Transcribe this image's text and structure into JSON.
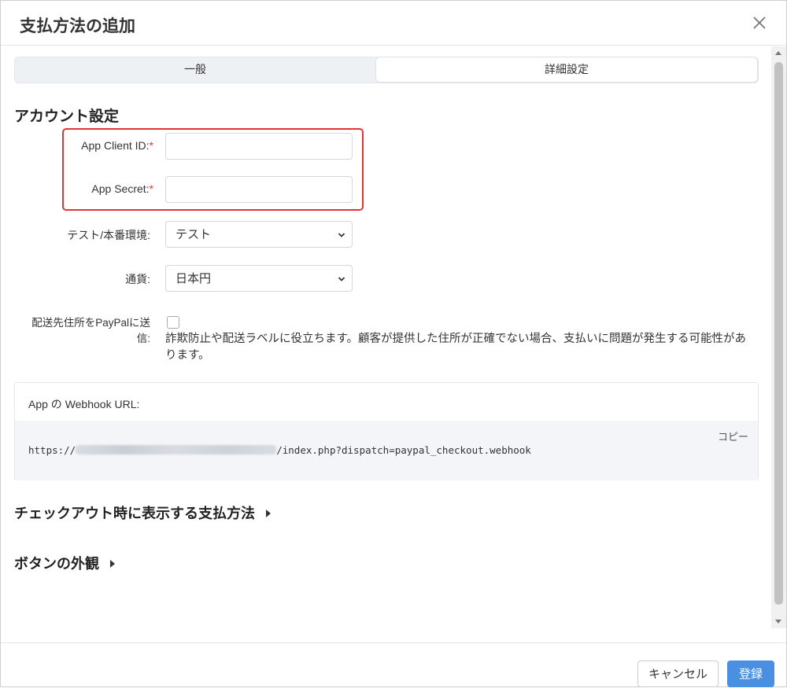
{
  "dialog": {
    "title": "支払方法の追加"
  },
  "tabs": [
    {
      "label": "一般"
    },
    {
      "label": "詳細設定"
    }
  ],
  "account": {
    "section_title": "アカウント設定",
    "client_id_label": "App Client ID:",
    "secret_label": "App Secret:",
    "required_mark": "*",
    "client_id_value": "",
    "secret_value": "",
    "env_label": "テスト/本番環境:",
    "env_value": "テスト",
    "currency_label": "通貨:",
    "currency_value": "日本円",
    "shipping_label_line1": "配送先住所をPayPalに送",
    "shipping_label_line2": "信:",
    "shipping_help": "詐欺防止や配送ラベルに役立ちます。顧客が提供した住所が正確でない場合、支払いに問題が発生する可能性があります。"
  },
  "webhook": {
    "label": "App の Webhook URL:",
    "url_prefix": "https://",
    "url_suffix": "/index.php?dispatch=paypal_checkout.webhook",
    "copy_label": "コピー"
  },
  "collapsibles": {
    "checkout_methods": "チェックアウト時に表示する支払方法",
    "button_appearance": "ボタンの外観"
  },
  "footer": {
    "cancel_label": "キャンセル",
    "submit_label": "登録"
  },
  "colors": {
    "required": "#e03535",
    "highlight_border": "#e03535",
    "primary_button": "#4a90e2"
  }
}
